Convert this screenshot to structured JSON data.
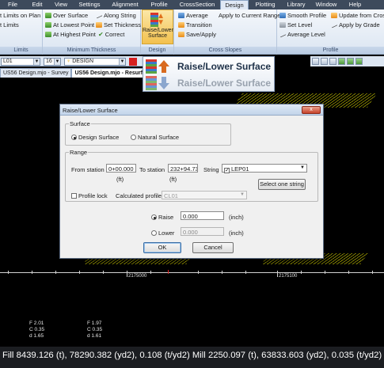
{
  "menu": {
    "items": [
      "File",
      "Edit",
      "View",
      "Settings",
      "Alignment",
      "Profile",
      "CrossSection",
      "Design",
      "Plotting",
      "Library",
      "Window",
      "Help"
    ],
    "active": "Design"
  },
  "ribbon": {
    "limits_group": {
      "label": "Limits",
      "items": [
        "t Limits on Plan",
        "t Limits"
      ]
    },
    "min_thickness_group": {
      "label": "Minimum Thickness",
      "items": [
        "Over Surface",
        "Along String",
        "At Lowest Point",
        "Set Thickness",
        "At Highest Point",
        "Correct"
      ]
    },
    "design_group": {
      "label": "Design",
      "button_label_line1": "Raise/Lower",
      "button_label_line2": "Surface"
    },
    "cross_slopes_group": {
      "label": "Cross Slopes",
      "items": [
        "Average",
        "Apply to Current Range",
        "Transition",
        "Save/Apply"
      ]
    },
    "profile_group": {
      "label": "Profile",
      "items": [
        "Smooth Profile",
        "Update from Cross",
        "Set Level",
        "Apply by Grade",
        "Average Level"
      ]
    }
  },
  "tooltip": {
    "title": "Raise/Lower Surface",
    "subtitle": "Raise/Lower Surface"
  },
  "doc_toolbar": {
    "string_value": "L01",
    "number_value": "16",
    "surface_value": "DESIGN"
  },
  "doc_tabs": [
    "US56 Design.mjo - Survey",
    "US56 Design.mjo - Resurface"
  ],
  "dialog": {
    "title": "Raise/Lower Surface",
    "close_label": "x",
    "surface": {
      "legend": "Surface",
      "design_label": "Design Surface",
      "natural_label": "Natural Surface",
      "selected": "design"
    },
    "range": {
      "legend": "Range",
      "from_label": "From station",
      "from_unit": "(ft)",
      "from_value": "0+00.000",
      "to_label": "To station",
      "to_unit": "(ft)",
      "to_value": "232+94.73",
      "string_label": "String",
      "string_value": "LEP01",
      "string_checked": "✓",
      "select_button": "Select one string",
      "profile_lock_label": "Profile lock",
      "calc_profile_label": "Calculated profile",
      "calc_profile_value": "CL01"
    },
    "raise_label": "Raise",
    "raise_value": "0.000",
    "raise_unit": "(inch)",
    "lower_label": "Lower",
    "lower_value": "0.000",
    "lower_unit": "(inch)",
    "ok_label": "OK",
    "cancel_label": "Cancel"
  },
  "canvas": {
    "stations": [
      "2175000",
      "2175100"
    ],
    "labels_left": [
      "F 2.01",
      "C 0.35",
      "d 1.65"
    ],
    "labels_right": [
      "F 1.97",
      "C 0.35",
      "d 1.61"
    ]
  },
  "status": {
    "text": "Fill 8439.126 (t), 78290.382 (yd2), 0.108 (t/yd2)   Mill 2250.097 (t), 63833.603 (yd2), 0.035 (t/yd2)"
  },
  "colors": {
    "accent": "#f3c14e",
    "canvas_bg": "#000000",
    "hatch": "#c7c400",
    "status_bg": "#1b1d21"
  }
}
